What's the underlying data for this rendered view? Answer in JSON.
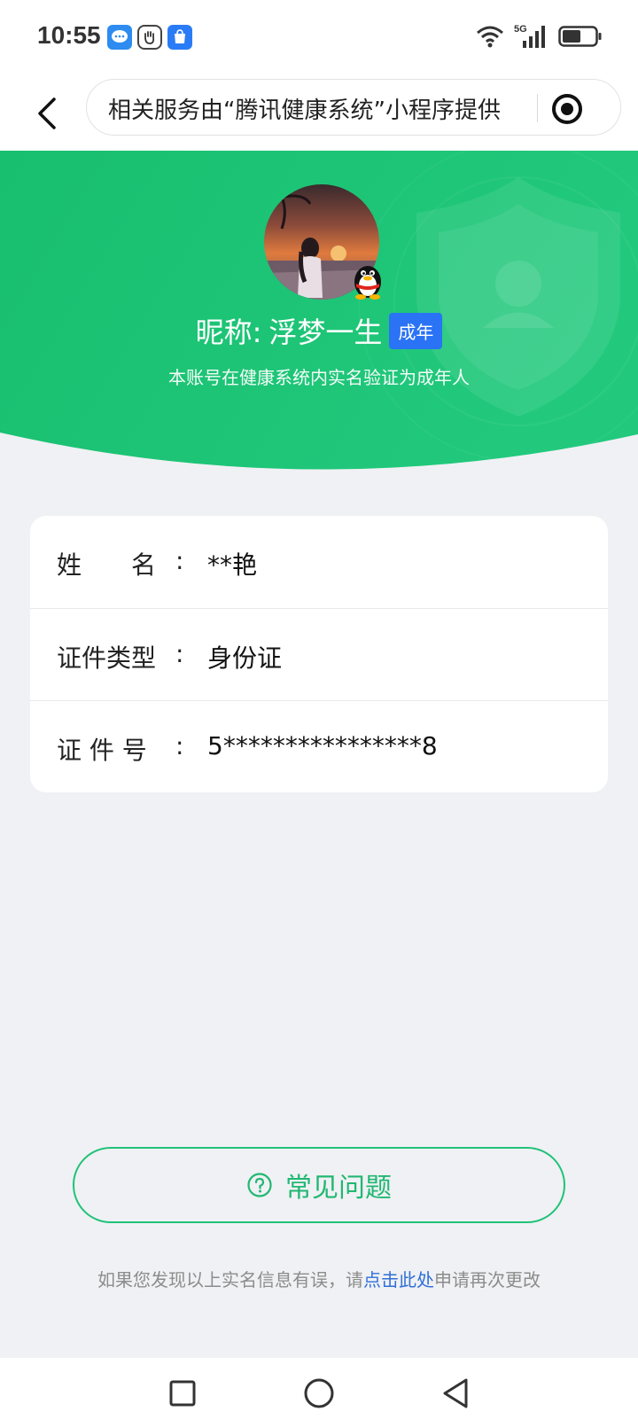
{
  "status_bar": {
    "time": "10:55",
    "network": "5G"
  },
  "nav": {
    "url_text": "相关服务由“腾讯健康系统”小程序提供"
  },
  "profile": {
    "nickname_label": "昵称:",
    "nickname": "浮梦一生",
    "age_badge": "成年",
    "verify_note": "本账号在健康系统内实名验证为成年人"
  },
  "info": {
    "rows": [
      {
        "label": "姓　　名",
        "colon": ":",
        "value": "**艳"
      },
      {
        "label": "证件类型",
        "colon": ":",
        "value": "身份证"
      },
      {
        "label": "证 件 号",
        "colon": ":",
        "value": "5****************8"
      }
    ]
  },
  "faq": {
    "label": "常见问题"
  },
  "footer": {
    "prefix": "如果您发现以上实名信息有误，请",
    "link": "点击此处",
    "suffix": "申请再次更改"
  },
  "colors": {
    "green": "#20c278",
    "badge_blue": "#2a73f5",
    "link_blue": "#2f6fd8"
  },
  "icons": [
    "back-arrow-icon",
    "target-icon",
    "question-circle-icon",
    "qq-penguin-icon",
    "wifi-icon",
    "signal-icon",
    "battery-icon"
  ]
}
